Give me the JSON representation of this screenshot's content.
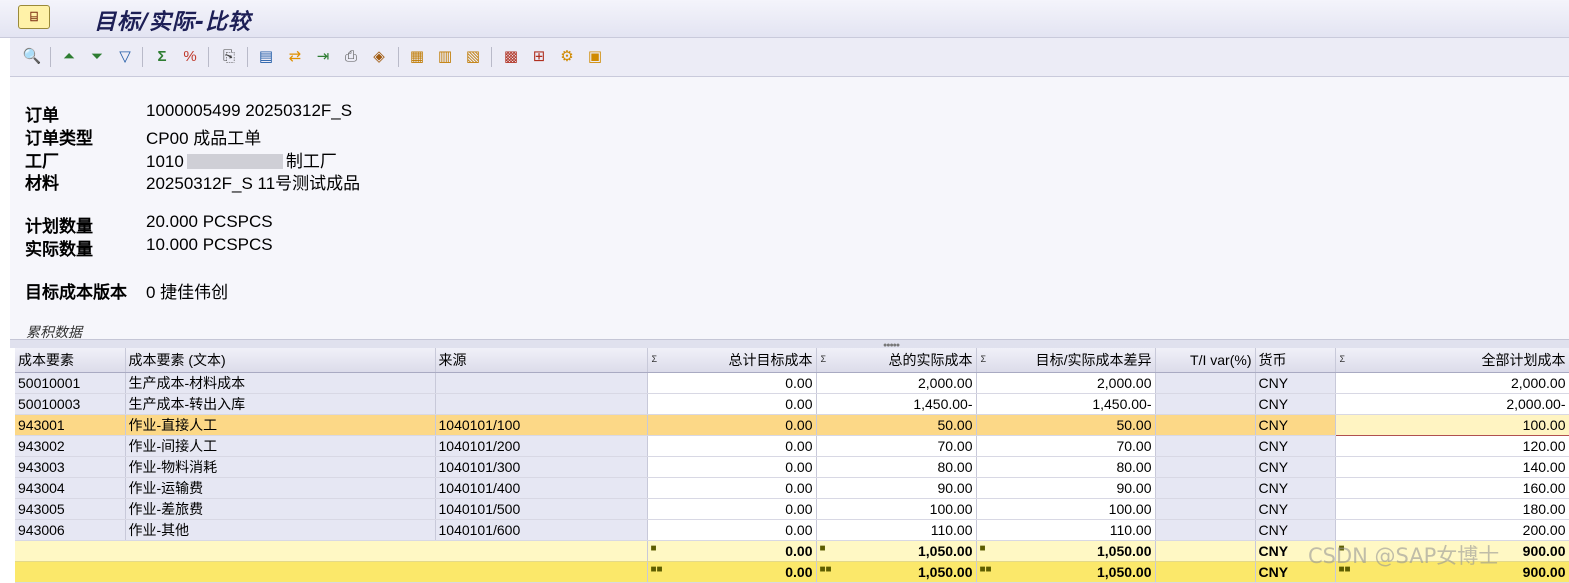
{
  "window": {
    "title": "目标/实际-比较"
  },
  "toolbar_icons": [
    "find-icon",
    "sort-ascending-icon",
    "sort-descending-icon",
    "filter-icon",
    "sum-icon",
    "subtotal-icon",
    "details-icon",
    "export-excel-icon",
    "layout-transfer-icon",
    "local-file-icon",
    "print-preview-icon",
    "graphic-icon",
    "change-layout-icon",
    "select-layout-icon",
    "save-layout-icon",
    "cost-element-icon",
    "structure-icon",
    "settings-icon",
    "variances-icon"
  ],
  "header": {
    "order_label": "订单",
    "order_value": "1000005499 20250312F_S",
    "order_type_label": "订单类型",
    "order_type_value": "CP00 成品工单",
    "plant_label": "工厂",
    "plant_code": "1010",
    "plant_suffix": "制工厂",
    "material_label": "材料",
    "material_value": "20250312F_S 11号测试成品",
    "planned_qty_label": "计划数量",
    "planned_qty_value": "20.000 PCSPCS",
    "actual_qty_label": "实际数量",
    "actual_qty_value": "10.000 PCSPCS",
    "target_version_label": "目标成本版本",
    "target_version_value": "0 捷佳伟创"
  },
  "section_label": "累积数据",
  "grid": {
    "columns": {
      "cost_element": "成本要素",
      "cost_element_text": "成本要素 (文本)",
      "origin": "来源",
      "total_target": "总计目标成本",
      "total_actual": "总的实际成本",
      "variance": "目标/实际成本差异",
      "ti_var": "T/I var(%)",
      "currency": "货币",
      "total_plan": "全部计划成本"
    },
    "rows": [
      [
        "50010001",
        "生产成本-材料成本",
        "",
        "0.00",
        "2,000.00",
        "2,000.00",
        "",
        "CNY",
        "2,000.00"
      ],
      [
        "50010003",
        "生产成本-转出入库",
        "",
        "0.00",
        "1,450.00-",
        "1,450.00-",
        "",
        "CNY",
        "2,000.00-"
      ],
      [
        "943001",
        "作业-直接人工",
        "1040101/100",
        "0.00",
        "50.00",
        "50.00",
        "",
        "CNY",
        "100.00"
      ],
      [
        "943002",
        "作业-间接人工",
        "1040101/200",
        "0.00",
        "70.00",
        "70.00",
        "",
        "CNY",
        "120.00"
      ],
      [
        "943003",
        "作业-物料消耗",
        "1040101/300",
        "0.00",
        "80.00",
        "80.00",
        "",
        "CNY",
        "140.00"
      ],
      [
        "943004",
        "作业-运输费",
        "1040101/400",
        "0.00",
        "90.00",
        "90.00",
        "",
        "CNY",
        "160.00"
      ],
      [
        "943005",
        "作业-差旅费",
        "1040101/500",
        "0.00",
        "100.00",
        "100.00",
        "",
        "CNY",
        "180.00"
      ],
      [
        "943006",
        "作业-其他",
        "1040101/600",
        "0.00",
        "110.00",
        "110.00",
        "",
        "CNY",
        "200.00"
      ]
    ],
    "subtotal": {
      "dots": "■",
      "total_target": "0.00",
      "total_actual": "1,050.00",
      "variance": "1,050.00",
      "currency": "CNY",
      "total_plan": "900.00"
    },
    "grand_total": {
      "dots": "■■",
      "total_target": "0.00",
      "total_actual": "1,050.00",
      "variance": "1,050.00",
      "currency": "CNY",
      "total_plan": "900.00"
    },
    "sigma": "Σ"
  },
  "watermark": "CSDN @SAP女博士"
}
